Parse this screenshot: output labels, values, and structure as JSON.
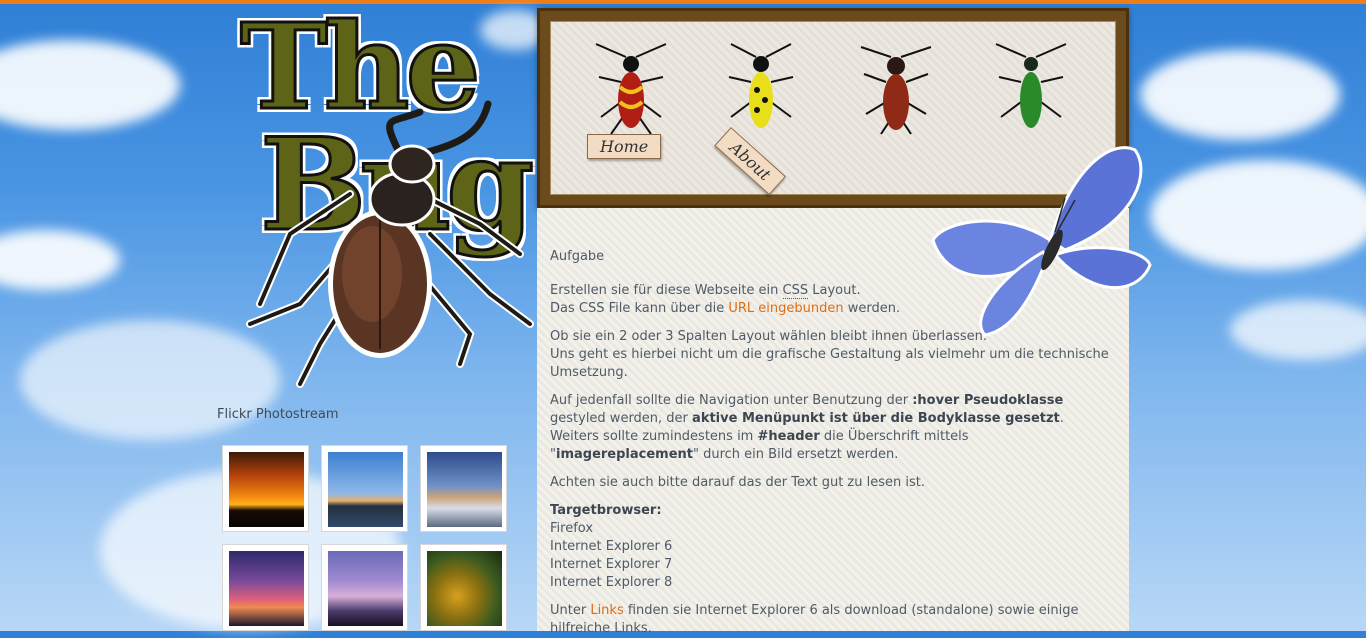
{
  "nav": {
    "items": [
      {
        "label": "Home"
      },
      {
        "label": "About"
      }
    ]
  },
  "logo": {
    "line1": "The",
    "line2": "Bug"
  },
  "content": {
    "heading": "Aufgabe",
    "p1_a": "Erstellen sie für diese Webseite ein ",
    "p1_css": "CSS",
    "p1_b": " Layout.",
    "p1_c": "Das CSS File kann über die ",
    "p1_link": "URL eingebunden",
    "p1_d": " werden.",
    "p2_a": "Ob sie ein 2 oder 3 Spalten Layout wählen bleibt ihnen überlassen.",
    "p2_b": "Uns geht es hierbei nicht um die grafische Gestaltung als vielmehr um die technische Umsetzung.",
    "p3_a": "Auf jedenfall sollte die Navigation unter Benutzung der ",
    "p3_b1": ":hover Pseudoklasse",
    "p3_c": " gestyled werden, der ",
    "p3_b2": "aktive Menüpunkt ist über die Bodyklasse gesetzt",
    "p3_d": ".",
    "p3_e": "Weiters sollte zumindestens im ",
    "p3_b3": "#header",
    "p3_f": " die Überschrift mittels \"",
    "p3_b4": "imagereplacement",
    "p3_g": "\" durch ein Bild ersetzt werden.",
    "p4": "Achten sie auch bitte darauf das der Text gut zu lesen ist.",
    "browsers_title": "Targetbrowser:",
    "browsers": [
      "Firefox",
      "Internet Explorer 6",
      "Internet Explorer 7",
      "Internet Explorer 8"
    ],
    "p6_a": "Unter ",
    "p6_link": "Links",
    "p6_b": " finden sie Internet Explorer 6 als download (standalone) sowie einige hilfreiche Links."
  },
  "flickr": {
    "title": "Flickr Photostream"
  }
}
